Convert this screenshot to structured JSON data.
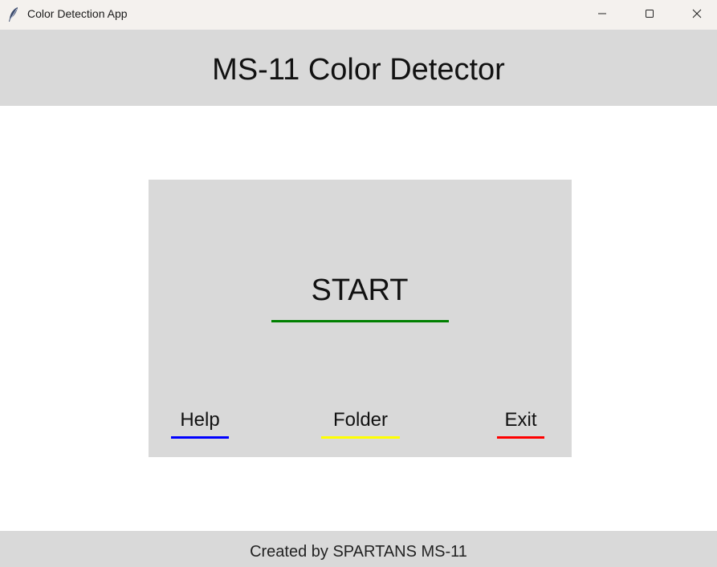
{
  "window": {
    "title": "Color Detection App",
    "icon": "feather-icon",
    "controls": {
      "minimize_icon": "minimize-icon",
      "maximize_icon": "maximize-icon",
      "close_icon": "close-icon"
    }
  },
  "header": {
    "title": "MS-11 Color Detector"
  },
  "panel": {
    "start": {
      "label": "START",
      "accent_color": "#008000"
    },
    "buttons": [
      {
        "id": "help",
        "label": "Help",
        "accent_color": "#0000ff"
      },
      {
        "id": "folder",
        "label": "Folder",
        "accent_color": "#ffff00"
      },
      {
        "id": "exit",
        "label": "Exit",
        "accent_color": "#ff0000"
      }
    ]
  },
  "footer": {
    "text": "Created by SPARTANS MS-11"
  },
  "colors": {
    "titlebar_bg": "#f4f1ee",
    "header_bg": "#d9d9d9",
    "panel_bg": "#d9d9d9",
    "footer_bg": "#d9d9d9",
    "body_bg": "#ffffff"
  }
}
